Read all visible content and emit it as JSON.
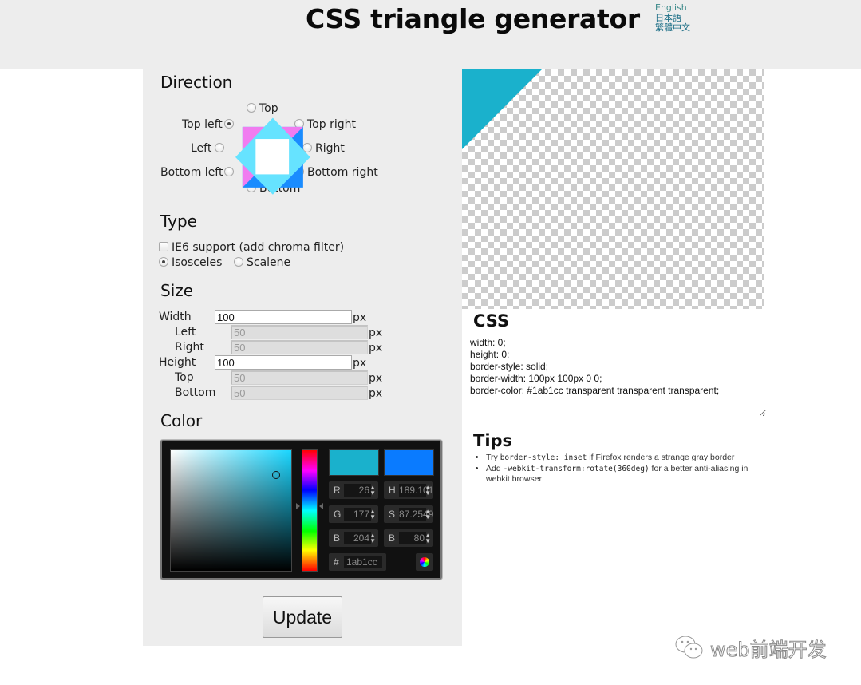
{
  "header": {
    "title": "CSS triangle generator",
    "languages": [
      {
        "label": "English",
        "current": true
      },
      {
        "label": "日本語",
        "current": false
      },
      {
        "label": "繁體中文",
        "current": false
      }
    ]
  },
  "direction": {
    "heading": "Direction",
    "options": {
      "top": "Top",
      "top_left": "Top left",
      "top_right": "Top right",
      "left": "Left",
      "right": "Right",
      "bottom_left": "Bottom left",
      "bottom_right": "Bottom right",
      "bottom": "Bottom"
    },
    "selected": "top_left"
  },
  "type": {
    "heading": "Type",
    "ie6_label": "IE6 support (add chroma filter)",
    "ie6_checked": false,
    "isosceles_label": "Isosceles",
    "scalene_label": "Scalene",
    "selected": "isosceles"
  },
  "size": {
    "heading": "Size",
    "unit": "px",
    "width_label": "Width",
    "width_value": "100",
    "left_label": "Left",
    "left_value": "50",
    "right_label": "Right",
    "right_value": "50",
    "height_label": "Height",
    "height_value": "100",
    "top_label": "Top",
    "top_value": "50",
    "bottom_label": "Bottom",
    "bottom_value": "50"
  },
  "color": {
    "heading": "Color",
    "current_swatch": "#1ab1cc",
    "original_swatch": "#0a7bff",
    "r_label": "R",
    "r_value": "26",
    "g_label": "G",
    "g_value": "177",
    "b_label": "B",
    "b_value": "204",
    "h_label": "H",
    "h_value": "189.101",
    "s_label": "S",
    "s_value": "87.2549",
    "v_label": "B",
    "v_value": "80",
    "hex_label": "#",
    "hex_value": "1ab1cc"
  },
  "update_button": "Update",
  "preview": {
    "triangle_color": "#1ab1cc"
  },
  "css_output": {
    "heading": "CSS",
    "code": "width: 0;\nheight: 0;\nborder-style: solid;\nborder-width: 100px 100px 0 0;\nborder-color: #1ab1cc transparent transparent transparent;"
  },
  "tips": {
    "heading": "Tips",
    "items": [
      {
        "pre": "Try ",
        "code": "border-style: inset",
        "post": " if Firefox renders a strange gray border"
      },
      {
        "pre": "Add ",
        "code": "-webkit-transform:rotate(360deg)",
        "post": " for a better anti-aliasing in webkit browser"
      }
    ]
  },
  "watermark": "web前端开发"
}
